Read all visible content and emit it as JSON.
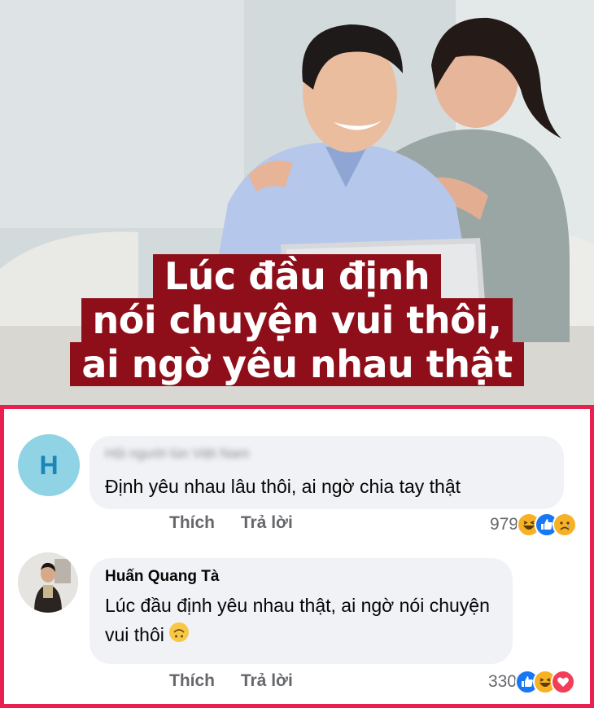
{
  "post": {
    "caption_lines": [
      "Lúc đầu định",
      "nói chuyện vui thôi,",
      "ai ngờ yêu nhau thật"
    ]
  },
  "colors": {
    "frame": "#e81f4f",
    "caption_bg": "#8e0f1a",
    "bubble_bg": "#f0f2f5",
    "action_text": "#65676b"
  },
  "comments": [
    {
      "avatar_letter": "H",
      "author": "Hội người lùn Việt Nam",
      "author_blurred": true,
      "text": "Định yêu nhau lâu thôi, ai ngờ chia tay thật",
      "like_label": "Thích",
      "reply_label": "Trả lời",
      "reaction_count": "979",
      "reactions": [
        "haha-icon",
        "like-icon",
        "sad-icon"
      ]
    },
    {
      "author": "Huấn Quang Tà",
      "text": "Lúc đầu định yêu nhau thật, ai ngờ nói chuyện vui thôi",
      "trailing_emoji": "upside-down-face-icon",
      "like_label": "Thích",
      "reply_label": "Trả lời",
      "reaction_count": "330",
      "reactions": [
        "like-icon",
        "haha-icon",
        "love-icon"
      ]
    }
  ]
}
